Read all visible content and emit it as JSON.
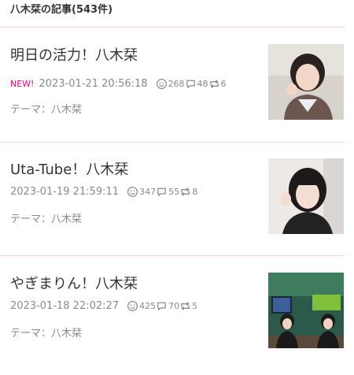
{
  "header": {
    "title": "八木栞の記事(543件)"
  },
  "entries": [
    {
      "title": "明日の活力！八木栞",
      "badge": "NEW!",
      "date": "2023-01-21 20:56:18",
      "likes": "268",
      "comments": "48",
      "reblogs": "6",
      "theme": "テーマ：八木栞"
    },
    {
      "title": "Uta-Tube！八木栞",
      "badge": "",
      "date": "2023-01-19 21:59:11",
      "likes": "347",
      "comments": "55",
      "reblogs": "8",
      "theme": "テーマ：八木栞"
    },
    {
      "title": "やぎまりん！八木栞",
      "badge": "",
      "date": "2023-01-18 22:02:27",
      "likes": "425",
      "comments": "70",
      "reblogs": "5",
      "theme": "テーマ：八木栞"
    }
  ],
  "icons": {
    "like": "smiley-icon",
    "comment": "comment-bubble-icon",
    "reblog": "reblog-arrows-icon"
  },
  "colors": {
    "accent": "#e4007f",
    "divider": "#f3d3dc",
    "meta_text": "#8a8a8a"
  }
}
